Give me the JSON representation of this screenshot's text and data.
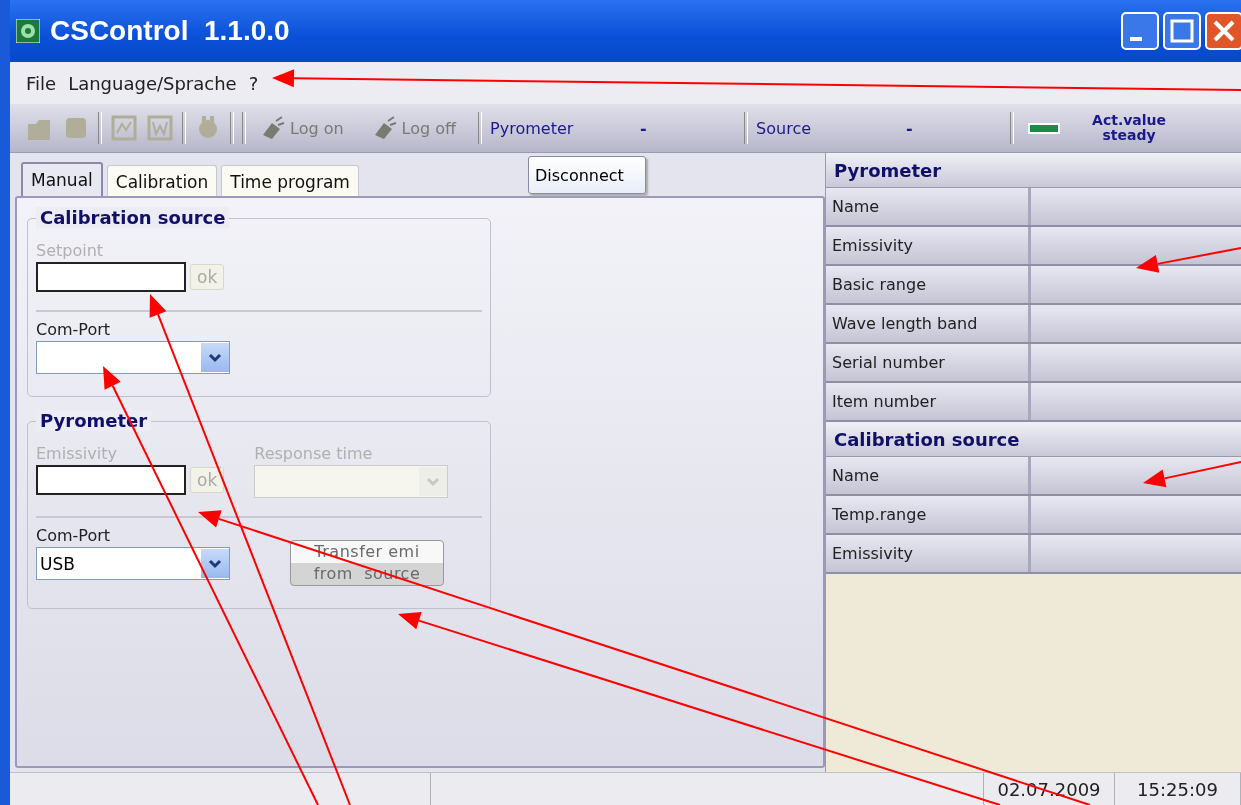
{
  "window": {
    "title": "CSControl  1.1.0.0"
  },
  "menu": [
    {
      "label": "File"
    },
    {
      "label": "Language/Sprache"
    },
    {
      "label": "?"
    }
  ],
  "toolbar": [
    {
      "kind": "icon",
      "disabled": true
    },
    {
      "kind": "icon",
      "disabled": true
    },
    {
      "kind": "separator"
    },
    {
      "kind": "icon",
      "disabled": true
    },
    {
      "kind": "icon",
      "disabled": true
    },
    {
      "kind": "separator"
    },
    {
      "kind": "icon",
      "disabled": true
    },
    {
      "kind": "separator"
    },
    {
      "kind": "separator"
    },
    {
      "kind": "button",
      "label": "Log on",
      "disabled": true
    },
    {
      "kind": "button",
      "label": "Log off",
      "disabled": true
    },
    {
      "kind": "separator"
    },
    {
      "kind": "status",
      "label": "Pyrometer",
      "value": "-"
    },
    {
      "kind": "separator"
    },
    {
      "kind": "status",
      "label": "Source",
      "value": "-"
    },
    {
      "kind": "separator"
    },
    {
      "kind": "led",
      "label": "Act.value steady",
      "color": "#1e8a4a"
    }
  ],
  "tooltip": {
    "text": "Disconnect"
  },
  "tabs": [
    {
      "label": "Manual",
      "selected": true
    },
    {
      "label": "Calibration",
      "selected": false
    },
    {
      "label": "Time program",
      "selected": false
    }
  ],
  "groups": [
    {
      "title": "Calibration source",
      "rows": [
        {
          "kind": "input",
          "label": "Setpoint",
          "disabled": true,
          "button": "ok"
        },
        {
          "kind": "select",
          "label": "Com-Port",
          "disabled": false
        }
      ]
    },
    {
      "title": "Pyrometer",
      "rows": [
        {
          "kind": "input_select",
          "label": "Emissivity",
          "disabled": true,
          "button": "ok",
          "label2": "Response time"
        },
        {
          "kind": "select_button",
          "label": "Com-Port",
          "disabled": false,
          "value": "USB",
          "button": "Transfer emi from  source"
        }
      ]
    }
  ],
  "info_sections": [
    {
      "title": "Pyrometer",
      "rows": [
        {
          "label": "Name"
        },
        {
          "label": "Emissivity"
        },
        {
          "label": "Basic range"
        },
        {
          "label": "Wave length band"
        },
        {
          "label": "Serial number"
        },
        {
          "label": "Item number"
        }
      ]
    },
    {
      "title": "Calibration source",
      "rows": [
        {
          "label": "Name"
        },
        {
          "label": "Temp.range"
        },
        {
          "label": "Emissivity"
        }
      ]
    }
  ],
  "status_bar": {
    "date": "02.07.2009",
    "time": "15:25:09"
  }
}
